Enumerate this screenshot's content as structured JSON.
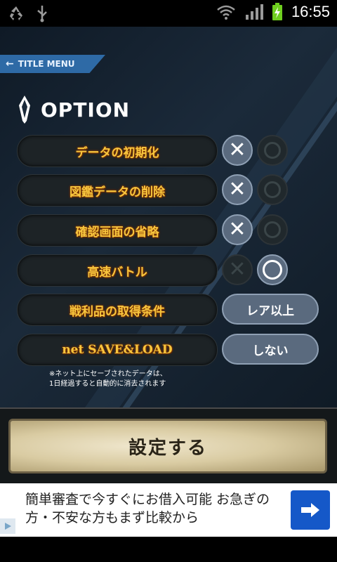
{
  "status_bar": {
    "time": "16:55",
    "icons": [
      "recycle-icon",
      "usb-icon",
      "wifi-icon",
      "signal-icon",
      "battery-charging-icon"
    ]
  },
  "header": {
    "back_label": "TITLE MENU",
    "title": "OPTION"
  },
  "options": [
    {
      "label": "データの初期化",
      "control": "toggle",
      "state": "x"
    },
    {
      "label": "図鑑データの削除",
      "control": "toggle",
      "state": "x"
    },
    {
      "label": "確認画面の省略",
      "control": "toggle",
      "state": "x"
    },
    {
      "label": "高速バトル",
      "control": "toggle",
      "state": "o"
    },
    {
      "label": "戦利品の取得条件",
      "control": "select",
      "value": "レア以上"
    },
    {
      "label": "net SAVE&LOAD",
      "control": "select",
      "value": "しない"
    }
  ],
  "note": {
    "line1": "※ネット上にセーブされたデータは、",
    "line2": "1日経過すると自動的に消去されます"
  },
  "footer": {
    "confirm_label": "設定する"
  },
  "ad": {
    "text": "簡単審査で今すぐにお借入可能 お急ぎの方・不安な方もまず比較から",
    "button_icon": "arrow-right-icon",
    "badge_icon": "adchoices-icon"
  },
  "colors": {
    "label_gold": "#f7c63e",
    "title_menu_blue": "#2e6aa6",
    "toggle_active": "#5a6a7e",
    "ad_button": "#1558c8"
  }
}
